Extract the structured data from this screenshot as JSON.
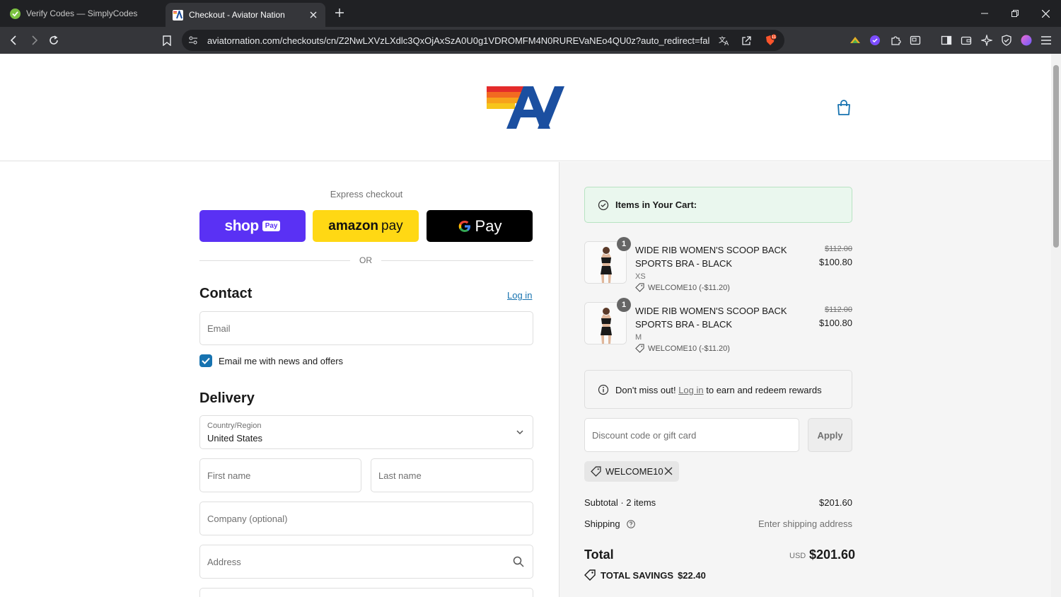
{
  "browser": {
    "tabs": [
      {
        "title": "Verify Codes — SimplyCodes",
        "active": false
      },
      {
        "title": "Checkout - Aviator Nation",
        "active": true
      }
    ],
    "url": "aviatornation.com/checkouts/cn/Z2NwLXVzLXdlc3QxOjAxSzA0U0g1VDROMFM4N0RUREVaNEo4QU0z?auto_redirect=fal...",
    "shields_badge": "11"
  },
  "checkout": {
    "express_label": "Express checkout",
    "shop_label": "shop",
    "shop_pay_badge": "Pay",
    "amazon_label": "amazon",
    "amazon_pay_label": "pay",
    "gpay_label": "Pay",
    "or_label": "OR",
    "contact": {
      "heading": "Contact",
      "login_label": "Log in",
      "email_placeholder": "Email",
      "newsletter_label": "Email me with news and offers",
      "newsletter_checked": true
    },
    "delivery": {
      "heading": "Delivery",
      "country_label": "Country/Region",
      "country_value": "United States",
      "first_name_placeholder": "First name",
      "last_name_placeholder": "Last name",
      "company_placeholder": "Company (optional)",
      "address_placeholder": "Address"
    }
  },
  "summary": {
    "banner": "Items in Your Cart:",
    "items": [
      {
        "qty": "1",
        "name": "WIDE RIB WOMEN'S SCOOP BACK SPORTS BRA - BLACK",
        "variant": "XS",
        "discount": "WELCOME10 (-$11.20)",
        "old_price": "$112.00",
        "price": "$100.80"
      },
      {
        "qty": "1",
        "name": "WIDE RIB WOMEN'S SCOOP BACK SPORTS BRA - BLACK",
        "variant": "M",
        "discount": "WELCOME10 (-$11.20)",
        "old_price": "$112.00",
        "price": "$100.80"
      }
    ],
    "rewards_prefix": "Don't miss out!",
    "rewards_link": "Log in",
    "rewards_suffix": "to earn and redeem rewards",
    "discount_placeholder": "Discount code or gift card",
    "apply_label": "Apply",
    "applied_code": "WELCOME10",
    "subtotal_label": "Subtotal · 2 items",
    "subtotal_value": "$201.60",
    "shipping_label": "Shipping",
    "shipping_value": "Enter shipping address",
    "total_label": "Total",
    "currency": "USD",
    "total_value": "$201.60",
    "savings_label": "TOTAL SAVINGS",
    "savings_value": "$22.40"
  },
  "colors": {
    "shop_pay": "#5a31f4",
    "amazon_pay": "#ffd814",
    "link": "#1773b0",
    "brand_blue": "#1b4fa0"
  }
}
